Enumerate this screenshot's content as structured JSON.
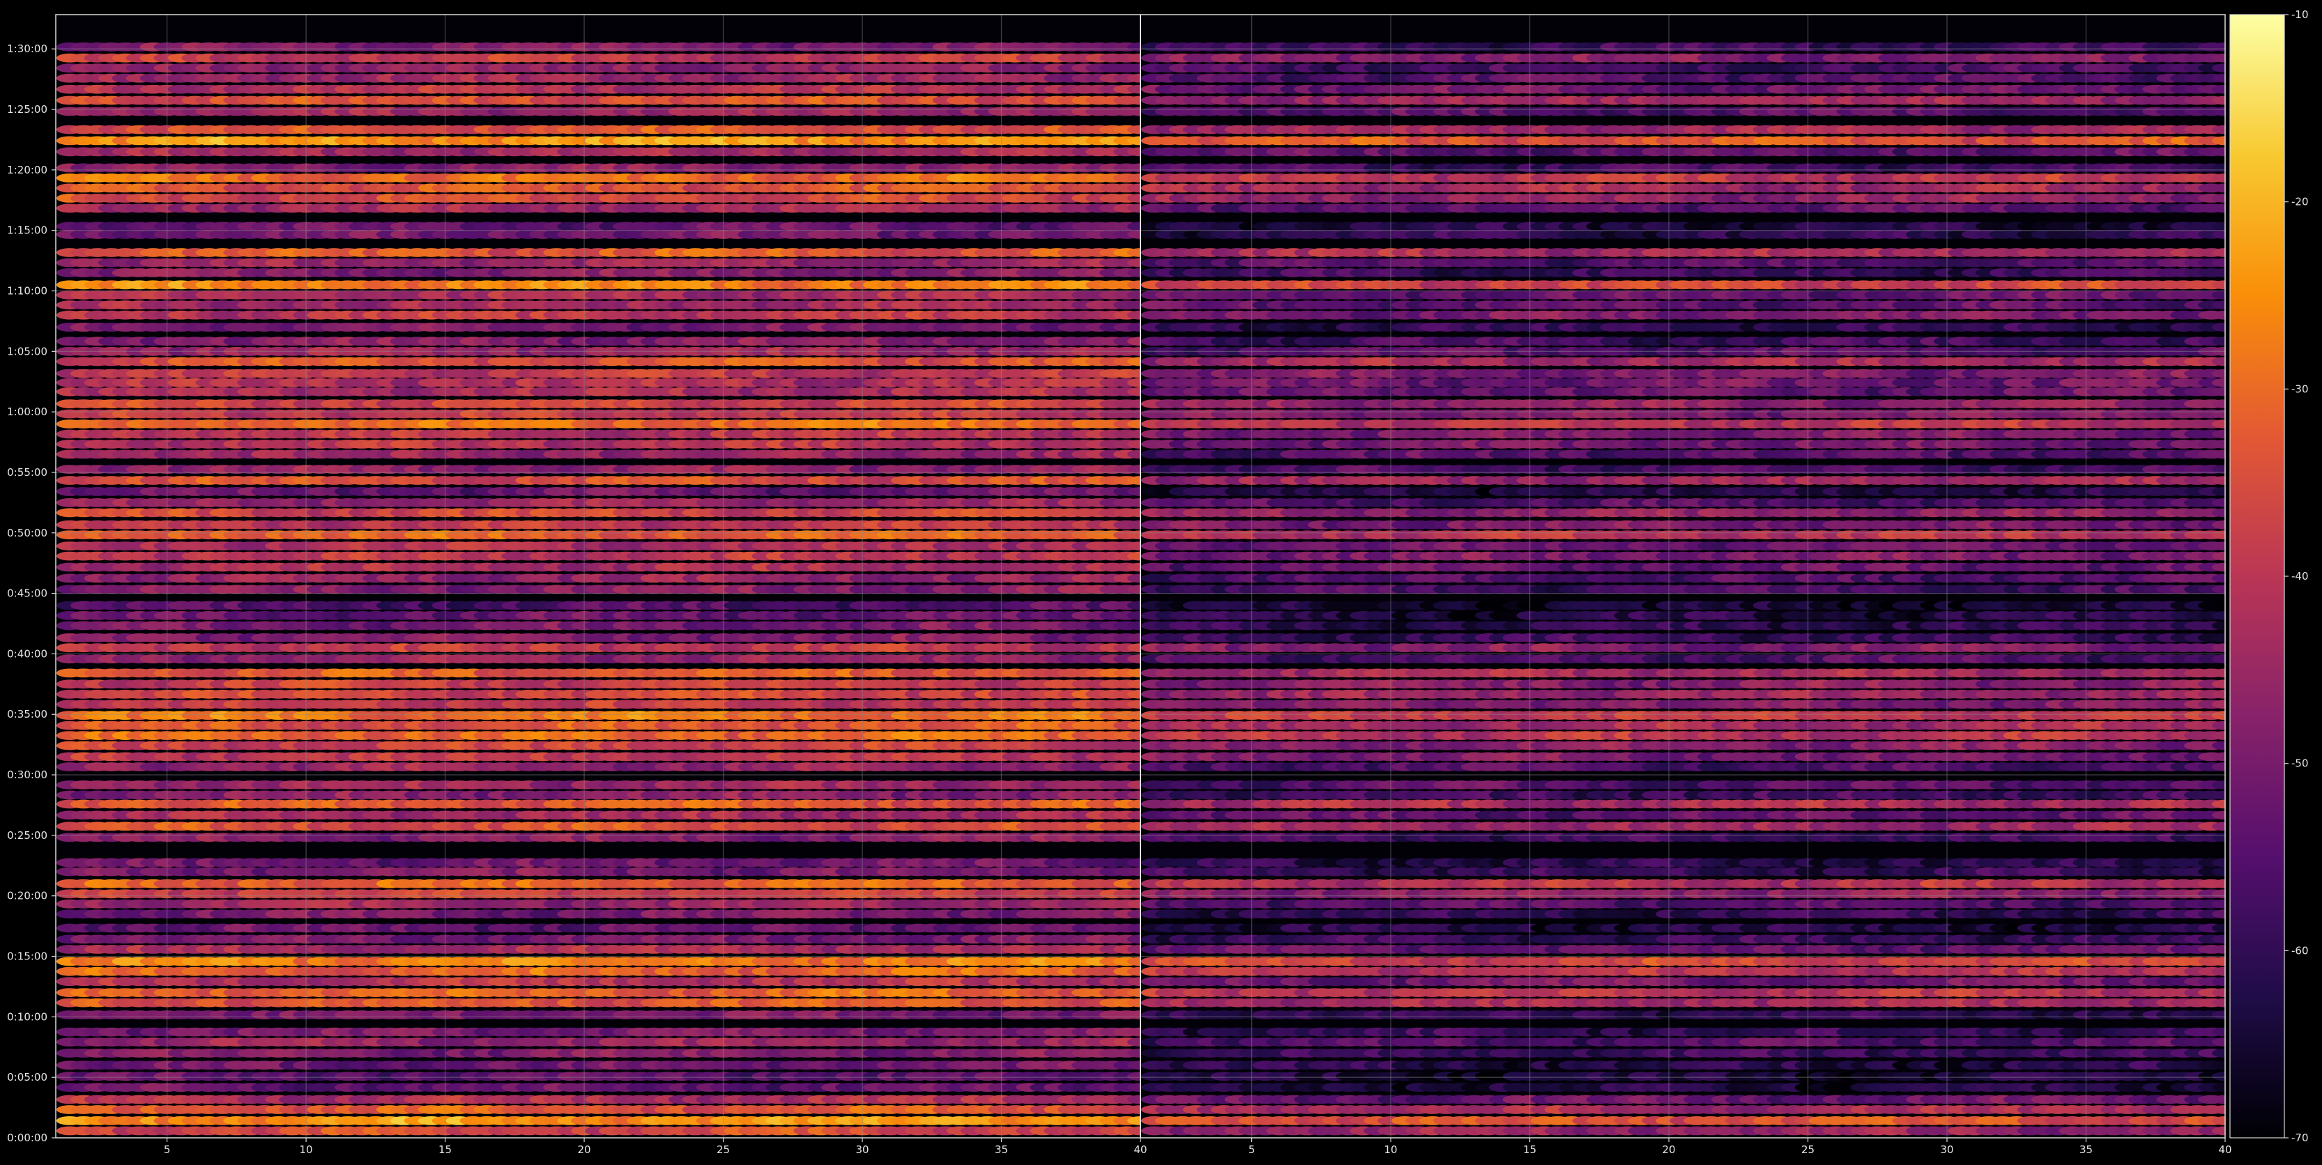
{
  "chart_data": {
    "type": "heatmap",
    "title": "",
    "xlabel": "",
    "ylabel": "",
    "colormap": "inferno",
    "colormap_stops": [
      "#000004",
      "#1f0c48",
      "#550f6d",
      "#88226a",
      "#ba3655",
      "#e35933",
      "#f98e09",
      "#f8c931",
      "#fcffa4"
    ],
    "background_color": "#000000",
    "grid": true,
    "panels": [
      {
        "xlim": [
          1,
          40
        ],
        "x_ticks": [
          5,
          10,
          15,
          20,
          25,
          30,
          35,
          40
        ]
      },
      {
        "xlim": [
          1,
          40
        ],
        "x_ticks": [
          5,
          10,
          15,
          20,
          25,
          30,
          35,
          40
        ]
      }
    ],
    "y_unit": "seconds",
    "ylim": [
      0,
      5570
    ],
    "y_ticks": [
      {
        "value": 0,
        "label": "0:00:00"
      },
      {
        "value": 300,
        "label": "0:05:00"
      },
      {
        "value": 600,
        "label": "0:10:00"
      },
      {
        "value": 900,
        "label": "0:15:00"
      },
      {
        "value": 1200,
        "label": "0:20:00"
      },
      {
        "value": 1500,
        "label": "0:25:00"
      },
      {
        "value": 1800,
        "label": "0:30:00"
      },
      {
        "value": 2100,
        "label": "0:35:00"
      },
      {
        "value": 2400,
        "label": "0:40:00"
      },
      {
        "value": 2700,
        "label": "0:45:00"
      },
      {
        "value": 3000,
        "label": "0:50:00"
      },
      {
        "value": 3300,
        "label": "0:55:00"
      },
      {
        "value": 3600,
        "label": "1:00:00"
      },
      {
        "value": 3900,
        "label": "1:05:00"
      },
      {
        "value": 4200,
        "label": "1:10:00"
      },
      {
        "value": 4500,
        "label": "1:15:00"
      },
      {
        "value": 4800,
        "label": "1:20:00"
      },
      {
        "value": 5100,
        "label": "1:25:00"
      },
      {
        "value": 5400,
        "label": "1:30:00"
      }
    ],
    "colorbar": {
      "range": [
        -70,
        -10
      ],
      "ticks": [
        -70,
        -60,
        -50,
        -40,
        -30,
        -20,
        -10
      ]
    },
    "bands": [
      {
        "t": 5410,
        "v": -49
      },
      {
        "t": 5355,
        "v": -39
      },
      {
        "t": 5305,
        "v": -47
      },
      {
        "t": 5255,
        "v": -45
      },
      {
        "t": 5200,
        "v": -41
      },
      {
        "t": 5145,
        "v": -34
      },
      {
        "t": 5090,
        "v": -45
      },
      {
        "t": 5000,
        "v": -34
      },
      {
        "t": 4945,
        "v": -24
      },
      {
        "t": 4890,
        "v": -44
      },
      {
        "t": 4810,
        "v": -48
      },
      {
        "t": 4760,
        "v": -30
      },
      {
        "t": 4710,
        "v": -34
      },
      {
        "t": 4660,
        "v": -36
      },
      {
        "t": 4610,
        "v": -44
      },
      {
        "t": 4520,
        "v": -53
      },
      {
        "t": 4480,
        "v": -51
      },
      {
        "t": 4390,
        "v": -33
      },
      {
        "t": 4340,
        "v": -46
      },
      {
        "t": 4290,
        "v": -49
      },
      {
        "t": 4230,
        "v": -27
      },
      {
        "t": 4180,
        "v": -43
      },
      {
        "t": 4130,
        "v": -44
      },
      {
        "t": 4080,
        "v": -40
      },
      {
        "t": 4020,
        "v": -50
      },
      {
        "t": 3950,
        "v": -48
      },
      {
        "t": 3900,
        "v": -45
      },
      {
        "t": 3850,
        "v": -34
      },
      {
        "t": 3790,
        "v": -40
      },
      {
        "t": 3745,
        "v": -42
      },
      {
        "t": 3700,
        "v": -43
      },
      {
        "t": 3640,
        "v": -37
      },
      {
        "t": 3590,
        "v": -39
      },
      {
        "t": 3540,
        "v": -30
      },
      {
        "t": 3490,
        "v": -40
      },
      {
        "t": 3440,
        "v": -41
      },
      {
        "t": 3390,
        "v": -45
      },
      {
        "t": 3315,
        "v": -47
      },
      {
        "t": 3260,
        "v": -35
      },
      {
        "t": 3205,
        "v": -53
      },
      {
        "t": 3150,
        "v": -46
      },
      {
        "t": 3100,
        "v": -37
      },
      {
        "t": 3040,
        "v": -40
      },
      {
        "t": 2990,
        "v": -31
      },
      {
        "t": 2935,
        "v": -42
      },
      {
        "t": 2885,
        "v": -40
      },
      {
        "t": 2830,
        "v": -43
      },
      {
        "t": 2775,
        "v": -46
      },
      {
        "t": 2720,
        "v": -48
      },
      {
        "t": 2640,
        "v": -56
      },
      {
        "t": 2590,
        "v": -53
      },
      {
        "t": 2540,
        "v": -51
      },
      {
        "t": 2480,
        "v": -49
      },
      {
        "t": 2430,
        "v": -39
      },
      {
        "t": 2375,
        "v": -46
      },
      {
        "t": 2305,
        "v": -33
      },
      {
        "t": 2250,
        "v": -38
      },
      {
        "t": 2200,
        "v": -36
      },
      {
        "t": 2150,
        "v": -39
      },
      {
        "t": 2095,
        "v": -29
      },
      {
        "t": 2045,
        "v": -34
      },
      {
        "t": 1995,
        "v": -31
      },
      {
        "t": 1945,
        "v": -38
      },
      {
        "t": 1890,
        "v": -40
      },
      {
        "t": 1840,
        "v": -46
      },
      {
        "t": 1750,
        "v": -45
      },
      {
        "t": 1700,
        "v": -48
      },
      {
        "t": 1655,
        "v": -33
      },
      {
        "t": 1600,
        "v": -44
      },
      {
        "t": 1545,
        "v": -35
      },
      {
        "t": 1490,
        "v": -48
      },
      {
        "t": 1365,
        "v": -52
      },
      {
        "t": 1320,
        "v": -50
      },
      {
        "t": 1260,
        "v": -31
      },
      {
        "t": 1210,
        "v": -37
      },
      {
        "t": 1160,
        "v": -45
      },
      {
        "t": 1110,
        "v": -50
      },
      {
        "t": 1040,
        "v": -53
      },
      {
        "t": 985,
        "v": -50
      },
      {
        "t": 935,
        "v": -43
      },
      {
        "t": 875,
        "v": -27
      },
      {
        "t": 825,
        "v": -31
      },
      {
        "t": 775,
        "v": -41
      },
      {
        "t": 720,
        "v": -31
      },
      {
        "t": 670,
        "v": -33
      },
      {
        "t": 610,
        "v": -50
      },
      {
        "t": 525,
        "v": -50
      },
      {
        "t": 475,
        "v": -46
      },
      {
        "t": 420,
        "v": -49
      },
      {
        "t": 360,
        "v": -52
      },
      {
        "t": 305,
        "v": -54
      },
      {
        "t": 250,
        "v": -53
      },
      {
        "t": 190,
        "v": -42
      },
      {
        "t": 140,
        "v": -33
      },
      {
        "t": 85,
        "v": -24
      },
      {
        "t": 35,
        "v": -36
      }
    ],
    "panel2_level_offset": -10
  }
}
